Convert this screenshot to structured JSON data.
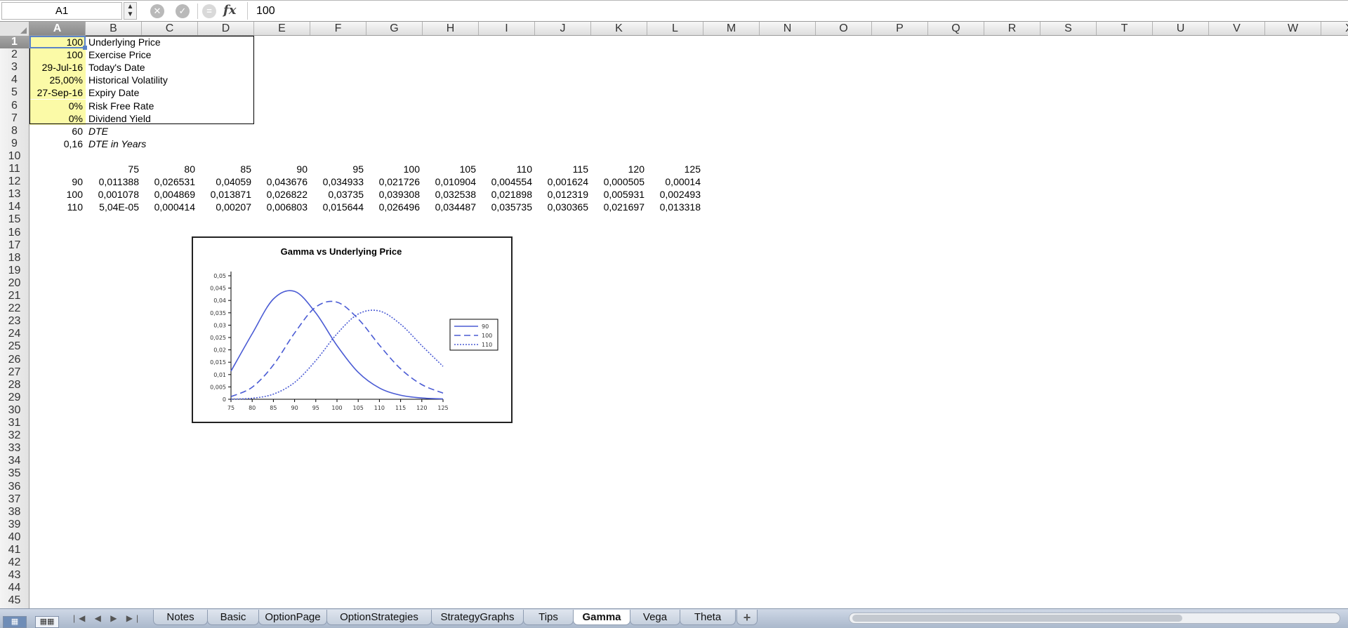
{
  "formula_bar": {
    "name_box": "A1",
    "stepper": "▲▼",
    "cancel_icon": "✕",
    "enter_icon": "✓",
    "fx": "fx",
    "content": "100"
  },
  "columns": [
    "A",
    "B",
    "C",
    "D",
    "E",
    "F",
    "G",
    "H",
    "I",
    "J",
    "K",
    "L",
    "M",
    "N",
    "O",
    "P",
    "Q",
    "R",
    "S",
    "T",
    "U",
    "V",
    "W",
    "X"
  ],
  "rows": [
    "1",
    "2",
    "3",
    "4",
    "5",
    "6",
    "7",
    "8",
    "9",
    "10",
    "11",
    "12",
    "13",
    "14",
    "15",
    "16",
    "17",
    "18",
    "19",
    "20",
    "21",
    "22",
    "23",
    "24",
    "25",
    "26",
    "27",
    "28",
    "29",
    "30",
    "31",
    "32",
    "33",
    "34",
    "35",
    "36",
    "37",
    "38",
    "39",
    "40",
    "41",
    "42",
    "43",
    "44",
    "45"
  ],
  "inputs": [
    {
      "value": "100",
      "label": "Underlying Price"
    },
    {
      "value": "100",
      "label": "Exercise Price"
    },
    {
      "value": "29-Jul-16",
      "label": "Today's Date"
    },
    {
      "value": "25,00%",
      "label": "Historical Volatility"
    },
    {
      "value": "27-Sep-16",
      "label": "Expiry Date"
    },
    {
      "value": "0%",
      "label": "Risk Free Rate"
    },
    {
      "value": "0%",
      "label": "Dividend Yield"
    }
  ],
  "derived": [
    {
      "value": "60",
      "label": "DTE"
    },
    {
      "value": "0,16",
      "label": "DTE in Years"
    }
  ],
  "gamma_table": {
    "strikes": [
      "75",
      "80",
      "85",
      "90",
      "95",
      "100",
      "105",
      "110",
      "115",
      "120",
      "125"
    ],
    "rows": [
      {
        "price": "90",
        "values": [
          "0,011388",
          "0,026531",
          "0,04059",
          "0,043676",
          "0,034933",
          "0,021726",
          "0,010904",
          "0,004554",
          "0,001624",
          "0,000505",
          "0,00014"
        ]
      },
      {
        "price": "100",
        "values": [
          "0,001078",
          "0,004869",
          "0,013871",
          "0,026822",
          "0,03735",
          "0,039308",
          "0,032538",
          "0,021898",
          "0,012319",
          "0,005931",
          "0,002493"
        ]
      },
      {
        "price": "110",
        "values": [
          "5,04E-05",
          "0,000414",
          "0,00207",
          "0,006803",
          "0,015644",
          "0,026496",
          "0,034487",
          "0,035735",
          "0,030365",
          "0,021697",
          "0,013318"
        ]
      }
    ]
  },
  "chart_data": {
    "type": "line",
    "title": "Gamma vs Underlying Price",
    "xlabel": "",
    "ylabel": "",
    "x": [
      75,
      80,
      85,
      90,
      95,
      100,
      105,
      110,
      115,
      120,
      125
    ],
    "ylim": [
      0,
      0.05
    ],
    "y_ticks": [
      "0",
      "0,005",
      "0,01",
      "0,015",
      "0,02",
      "0,025",
      "0,03",
      "0,035",
      "0,04",
      "0,045",
      "0,05"
    ],
    "x_ticks": [
      "75",
      "80",
      "85",
      "90",
      "95",
      "100",
      "105",
      "110",
      "115",
      "120",
      "125"
    ],
    "grid": false,
    "legend_position": "right",
    "series": [
      {
        "name": "90",
        "style": "solid",
        "color": "#4a5bd4",
        "values": [
          0.011388,
          0.026531,
          0.04059,
          0.043676,
          0.034933,
          0.021726,
          0.010904,
          0.004554,
          0.001624,
          0.000505,
          0.00014
        ]
      },
      {
        "name": "100",
        "style": "dashed",
        "color": "#4a5bd4",
        "values": [
          0.001078,
          0.004869,
          0.013871,
          0.026822,
          0.03735,
          0.039308,
          0.032538,
          0.021898,
          0.012319,
          0.005931,
          0.002493
        ]
      },
      {
        "name": "110",
        "style": "dotted",
        "color": "#4a5bd4",
        "values": [
          5.04e-05,
          0.000414,
          0.00207,
          0.006803,
          0.015644,
          0.026496,
          0.034487,
          0.035735,
          0.030365,
          0.021697,
          0.013318
        ]
      }
    ]
  },
  "sheet_tabs": [
    "Notes",
    "Basic",
    "OptionPage",
    "OptionStrategies",
    "StrategyGraphs",
    "Tips",
    "Gamma",
    "Vega",
    "Theta"
  ],
  "active_tab": "Gamma",
  "add_sheet": "+",
  "nav_arrows": "|◀ ◀ ▶ ▶|",
  "view_buttons": [
    "▦",
    "▦▦"
  ]
}
